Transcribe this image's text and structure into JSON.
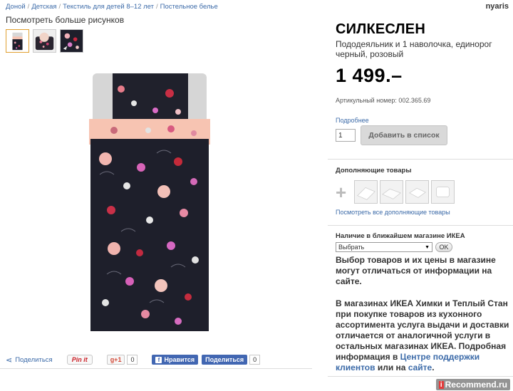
{
  "breadcrumb": {
    "items": [
      "Доной",
      "Детская",
      "Текстиль для детей 8–12 лет",
      "Постельное белье"
    ],
    "separator": "/"
  },
  "watermark_top": "nyaris",
  "gallery": {
    "more_images_label": "Посмотреть больше рисунков",
    "thumbnails": [
      "bedding-thumb-1",
      "bedding-thumb-2",
      "bedding-thumb-3"
    ]
  },
  "product": {
    "name": "СИЛКЕСЛЕН",
    "description": "Пододеяльник и 1 наволочка, единорог черный, розовый",
    "price": "1 499.–",
    "article": "Артикульный номер: 002.365.69",
    "more_link": "Подробнее",
    "quantity": "1",
    "add_button": "Добавить в список"
  },
  "complementary": {
    "title": "Дополняющие товары",
    "see_all": "Посмотреть все дополняющие товары"
  },
  "store": {
    "title": "Наличие в ближайшем магазине ИКЕА",
    "select_value": "Выбрать",
    "ok_button": "OK",
    "notice1": "Выбор товаров и их цены в магазине могут отличаться от информации на сайте.",
    "notice2_text1": "В магазинах ИКЕА Химки и Теплый Стан при покупке товаров из кухонного ассортимента услуга выдачи и доставки отличается от аналогичной услуги в остальных магазинах ИКЕА. Подробная информация в ",
    "notice2_link1": "Центре поддержки клиентов",
    "notice2_text2": " или на ",
    "notice2_link2": "сайте",
    "notice2_text3": "."
  },
  "social": {
    "share": "Поделиться",
    "pinit": "Pin it",
    "gplus": "g+1",
    "gplus_count": "0",
    "fb_like": "Нравится",
    "fb_share": "Поделиться",
    "fb_count": "0"
  },
  "watermark_bottom": {
    "irbox": "i",
    "text": "Recommend.ru"
  },
  "colors": {
    "link": "#3b6aa8",
    "duvet_dark": "#1e1f2b",
    "pillow_pink": "#f7c4b2",
    "button_grey": "#d9d9d9"
  }
}
